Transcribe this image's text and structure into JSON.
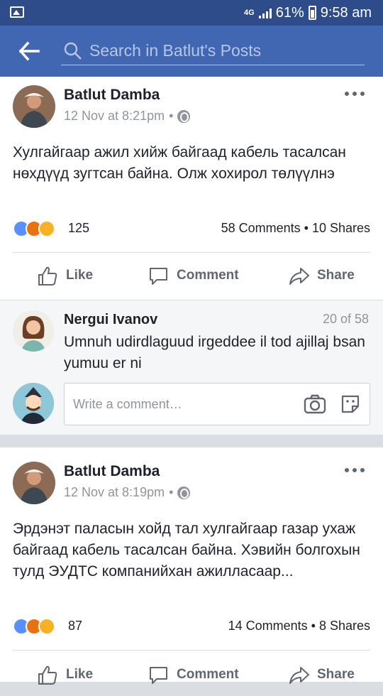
{
  "status_bar": {
    "network": "4G",
    "battery": "61%",
    "time": "9:58 am"
  },
  "search": {
    "placeholder": "Search in Batlut's Posts"
  },
  "posts": [
    {
      "author": "Batlut Damba",
      "timestamp": "12 Nov at 8:21pm",
      "privacy_separator": "•",
      "text": "Хулгайгаар ажил хийж байгаад кабель тасалсан нөхдүүд зугтсан байна. Олж хохирол төлүүлнэ",
      "reactions": [
        "like",
        "angry",
        "wow"
      ],
      "reaction_count": "125",
      "comments_shares": "58 Comments • 10 Shares",
      "actions": {
        "like": "Like",
        "comment": "Comment",
        "share": "Share"
      }
    },
    {
      "author": "Batlut Damba",
      "timestamp": "12 Nov at 8:19pm",
      "privacy_separator": "•",
      "text": "Эрдэнэт паласын хойд тал хулгайгаар газар ухаж байгаад кабель тасалсан байна. Хэвийн болгохын тулд ЭУДТС компанийхан ажилласаар...",
      "reactions": [
        "like",
        "angry",
        "sad"
      ],
      "reaction_count": "87",
      "comments_shares": "14 Comments • 8 Shares",
      "actions": {
        "like": "Like",
        "comment": "Comment",
        "share": "Share"
      }
    }
  ],
  "comment_preview": {
    "author": "Nergui Ivanov",
    "counter": "20 of 58",
    "text": "Umnuh udirdlaguud irgeddee il tod ajillaj bsan yumuu er ni"
  },
  "comment_input": {
    "placeholder": "Write a comment…"
  },
  "colors": {
    "facebook_blue": "#4267b2",
    "status_blue": "#2f4c8a",
    "text": "#1d2129",
    "muted": "#90949c"
  }
}
